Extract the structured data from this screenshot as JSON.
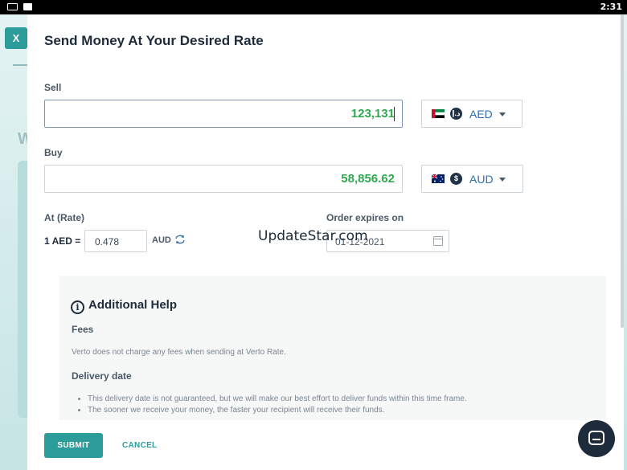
{
  "status_bar": {
    "time": "2:31"
  },
  "background": {
    "close_label": "X",
    "heading_fragment": "W"
  },
  "modal": {
    "title": "Send Money At Your Desired Rate",
    "sell": {
      "label": "Sell",
      "amount": "123,131",
      "currency": "AED",
      "flag_icon": "uae-flag-icon",
      "coin_icon": "dirham-icon",
      "coin_symbol": "د.إ"
    },
    "buy": {
      "label": "Buy",
      "amount": "58,856.62",
      "currency": "AUD",
      "flag_icon": "australia-flag-icon",
      "coin_icon": "dollar-icon",
      "coin_symbol": "$"
    },
    "rate": {
      "label": "At (Rate)",
      "prefix": "1 AED =",
      "value": "0.478",
      "suffix": "AUD"
    },
    "expiry": {
      "label": "Order expires on",
      "value": "01-12-2021"
    },
    "help": {
      "title": "Additional Help",
      "fees_heading": "Fees",
      "fees_text": "Verto does not charge any fees when sending at Verto Rate.",
      "delivery_heading": "Delivery date",
      "delivery_points": [
        "This delivery date is not guaranteed, but we will make our best effort to deliver funds within this time frame.",
        "The sooner we receive your money, the faster your recipient will receive their funds."
      ]
    },
    "submit_label": "SUBMIT",
    "cancel_label": "CANCEL"
  },
  "watermark": "UpdateStar.com",
  "colors": {
    "accent": "#2c9c9a",
    "amount_green": "#2fa84f",
    "currency_blue": "#2b6fb0",
    "dark": "#1e2b3b"
  }
}
